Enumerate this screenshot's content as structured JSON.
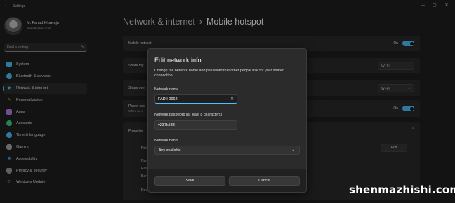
{
  "window": {
    "title": "Settings",
    "back_glyph": "←",
    "controls": [
      "—",
      "▢",
      "✕"
    ]
  },
  "profile": {
    "name": "M. Fahad Khawaja",
    "email": "sheel6@live.com"
  },
  "search": {
    "placeholder": "Find a setting",
    "icon": "search-icon"
  },
  "nav": [
    {
      "label": "System",
      "icon": "system-icon",
      "color": "#4cc2ff"
    },
    {
      "label": "Bluetooth & devices",
      "icon": "bluetooth-icon",
      "color": "#4cc2ff"
    },
    {
      "label": "Network & internet",
      "icon": "network-icon",
      "color": "#4cc2ff",
      "active": true
    },
    {
      "label": "Personalization",
      "icon": "brush-icon",
      "color": "#e8a25a"
    },
    {
      "label": "Apps",
      "icon": "apps-icon",
      "color": "#b880e6"
    },
    {
      "label": "Accounts",
      "icon": "accounts-icon",
      "color": "#3dd18b"
    },
    {
      "label": "Time & language",
      "icon": "globe-icon",
      "color": "#4cc2ff"
    },
    {
      "label": "Gaming",
      "icon": "gaming-icon",
      "color": "#aaaaaa"
    },
    {
      "label": "Accessibility",
      "icon": "accessibility-icon",
      "color": "#4cc2ff"
    },
    {
      "label": "Privacy & security",
      "icon": "shield-icon",
      "color": "#9a9a9a"
    },
    {
      "label": "Windows Update",
      "icon": "update-icon",
      "color": "#4cc2ff"
    }
  ],
  "breadcrumb": {
    "parent": "Network & internet",
    "separator": "›",
    "current": "Mobile hotspot"
  },
  "main": {
    "hotspot_title": "Mobile hotspot",
    "hotspot_state": "On",
    "share_my_label": "Share my",
    "share_my_value": "Wi-Fi",
    "share_over_label": "Share ove",
    "share_over_value": "Wi-Fi",
    "power_saving_label": "Power sav",
    "power_saving_sub": "When no d",
    "power_saving_state": "On",
    "properties_label": "Propertie",
    "prop_rows": [
      "Net",
      "Nar",
      "Pas",
      "Bar",
      "Dev"
    ],
    "edit_label": "Edit"
  },
  "dialog": {
    "title": "Edit network info",
    "description": "Change the network name and password that other people use for your shared connection.",
    "name_label": "Network name",
    "name_value": "FADII 0662",
    "clear_glyph": "✕",
    "password_label": "Network password (at least 8 characters)",
    "password_value": "v237k538",
    "band_label": "Network band",
    "band_value": "Any available",
    "save_label": "Save",
    "cancel_label": "Cancel"
  },
  "watermark": "shenmazhishi.com",
  "accent_color": "#4cc2ff"
}
